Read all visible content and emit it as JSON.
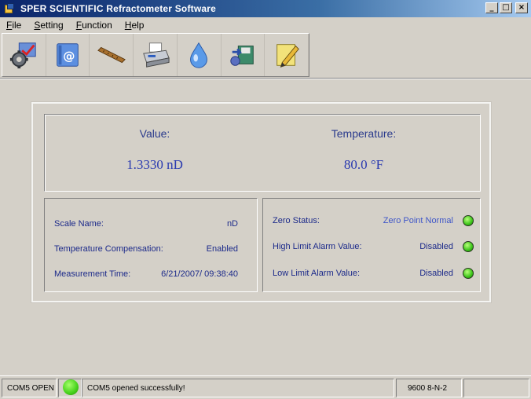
{
  "window": {
    "title": "SPER SCIENTIFIC Refractometer Software",
    "controls": [
      "_",
      "□",
      "×"
    ]
  },
  "menu": [
    {
      "first": "F",
      "rest": "ile"
    },
    {
      "first": "S",
      "rest": "etting"
    },
    {
      "first": "F",
      "rest": "unction"
    },
    {
      "first": "H",
      "rest": "elp"
    }
  ],
  "toolbar": {
    "icons": [
      "settings-gear-icon",
      "email-icon",
      "ruler-icon",
      "printer-icon",
      "water-drop-icon",
      "save-export-icon",
      "notes-pencil-icon"
    ]
  },
  "measurement": {
    "value_label": "Value:",
    "value": "1.3330 nD",
    "temperature_label": "Temperature:",
    "temperature": "80.0 °F"
  },
  "details": {
    "scale_name_label": "Scale Name:",
    "scale_name": "nD",
    "temp_comp_label": "Temperature Compensation:",
    "temp_comp": "Enabled",
    "measurement_time_label": "Measurement Time:",
    "measurement_time": "6/21/2007/ 09:38:40"
  },
  "status_panel": {
    "zero_status_label": "Zero Status:",
    "zero_status": "Zero Point Normal",
    "high_limit_label": "High Limit Alarm Value:",
    "high_limit": "Disabled",
    "low_limit_label": "Low Limit Alarm Value:",
    "low_limit": "Disabled",
    "led_color": "#3cc41a"
  },
  "statusbar": {
    "port": "COM5 OPEN",
    "message": "COM5 opened successfully!",
    "settings": "9600 8-N-2",
    "extra": ""
  }
}
